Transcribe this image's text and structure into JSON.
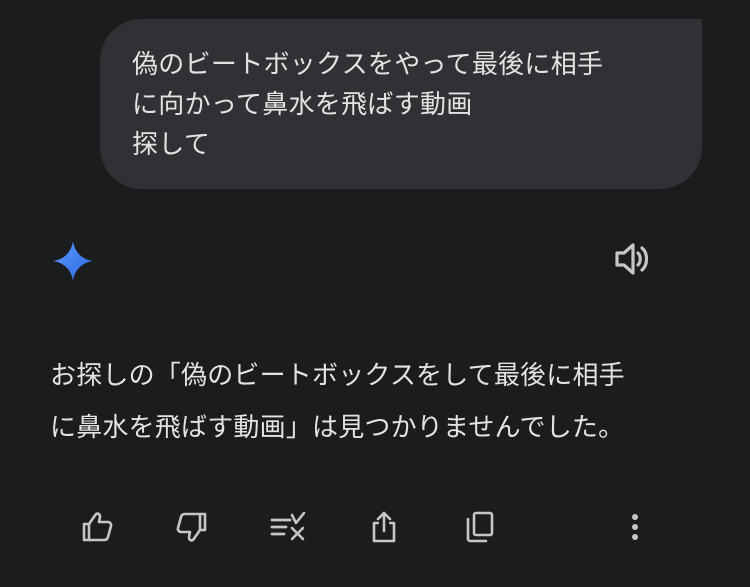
{
  "conversation": {
    "user_message": {
      "lines": [
        "偽のビートボックスをやって最後に相手",
        "に向かって鼻水を飛ばす動画",
        "探して"
      ]
    },
    "assistant_message": {
      "avatar_icon": "gemini-sparkle-icon",
      "lines": [
        "お探しの「偽のビートボックスをして最後に相手",
        "に鼻水を飛ばす動画」は見つかりませんでした。"
      ]
    }
  },
  "actions": {
    "read_aloud_icon": "speaker-icon",
    "buttons": [
      "thumbs-up-icon",
      "thumbs-down-icon",
      "modify-response-icon",
      "share-icon",
      "copy-icon",
      "more-vert-icon"
    ]
  },
  "colors": {
    "background": "#1b1c1e",
    "bubble": "#303134",
    "text": "#e3e3e3",
    "icon": "#c4c7c5",
    "sparkle_start": "#4f8df7",
    "sparkle_end": "#2d6be4"
  }
}
